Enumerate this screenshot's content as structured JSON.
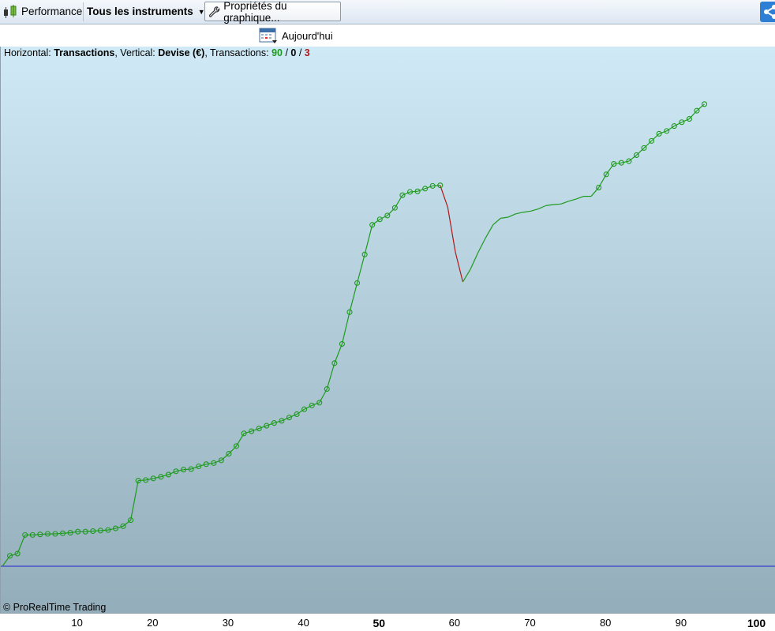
{
  "toolbar": {
    "performance_label": "Performance",
    "instruments_label": "Tous les instruments",
    "properties_label": "Propriétés du graphique..."
  },
  "subbar": {
    "today_label": "Aujourd'hui"
  },
  "info": {
    "horizontal_prefix": "Horizontal: ",
    "horizontal_value": "Transactions",
    "vertical_prefix": ", Vertical: ",
    "vertical_value": "Devise (€)",
    "transactions_prefix": ", Transactions: ",
    "winning": "90",
    "sep1": " / ",
    "neutral": "0",
    "sep2": " / ",
    "losing": "3"
  },
  "copyright": "© ProRealTime Trading",
  "colors": {
    "gain": "#1e9a1e",
    "loss": "#b01818",
    "baseline": "#2222cc"
  },
  "chart_data": {
    "type": "line",
    "x_ticks": [
      "10",
      "20",
      "30",
      "40",
      "50",
      "60",
      "70",
      "80",
      "90",
      "100"
    ],
    "major_ticks": [
      "50",
      "100"
    ],
    "xlim": [
      0,
      100
    ],
    "ylim": [
      0,
      100
    ],
    "series": [
      {
        "points": [
          [
            0,
            0
          ],
          [
            1,
            1.9
          ],
          [
            2,
            2.3
          ],
          [
            3,
            5.7
          ],
          [
            4,
            5.7
          ],
          [
            5,
            5.8
          ],
          [
            6,
            5.9
          ],
          [
            7,
            5.9
          ],
          [
            8,
            6.0
          ],
          [
            9,
            6.1
          ],
          [
            10,
            6.3
          ],
          [
            11,
            6.3
          ],
          [
            12,
            6.4
          ],
          [
            13,
            6.5
          ],
          [
            14,
            6.6
          ],
          [
            15,
            6.9
          ],
          [
            16,
            7.3
          ],
          [
            17,
            8.4
          ],
          [
            18,
            15.6
          ],
          [
            19,
            15.7
          ],
          [
            20,
            16.0
          ],
          [
            21,
            16.3
          ],
          [
            22,
            16.7
          ],
          [
            23,
            17.3
          ],
          [
            24,
            17.6
          ],
          [
            25,
            17.7
          ],
          [
            26,
            18.2
          ],
          [
            27,
            18.6
          ],
          [
            28,
            18.8
          ],
          [
            29,
            19.3
          ],
          [
            30,
            20.5
          ],
          [
            31,
            21.9
          ],
          [
            32,
            24.2
          ],
          [
            33,
            24.6
          ],
          [
            34,
            25.1
          ],
          [
            35,
            25.6
          ],
          [
            36,
            26.1
          ],
          [
            37,
            26.5
          ],
          [
            38,
            27.1
          ],
          [
            39,
            27.7
          ],
          [
            40,
            28.6
          ],
          [
            41,
            29.3
          ],
          [
            42,
            29.8
          ],
          [
            43,
            32.3
          ],
          [
            44,
            37.0
          ],
          [
            45,
            40.5
          ],
          [
            46,
            46.3
          ],
          [
            47,
            51.6
          ],
          [
            48,
            56.8
          ],
          [
            49,
            62.2
          ],
          [
            50,
            63.2
          ],
          [
            51,
            63.9
          ],
          [
            52,
            65.3
          ],
          [
            53,
            67.6
          ],
          [
            54,
            68.2
          ],
          [
            55,
            68.3
          ],
          [
            56,
            68.8
          ],
          [
            57,
            69.3
          ],
          [
            58,
            69.4
          ],
          [
            59,
            65.4
          ],
          [
            60,
            57.3
          ],
          [
            61,
            51.8
          ],
          [
            62,
            54.1
          ],
          [
            63,
            57.1
          ],
          [
            64,
            59.8
          ],
          [
            65,
            62.2
          ],
          [
            66,
            63.4
          ],
          [
            67,
            63.6
          ],
          [
            68,
            64.2
          ],
          [
            69,
            64.5
          ],
          [
            70,
            64.7
          ],
          [
            71,
            65.1
          ],
          [
            72,
            65.7
          ],
          [
            73,
            65.9
          ],
          [
            74,
            66.0
          ],
          [
            75,
            66.5
          ],
          [
            76,
            66.9
          ],
          [
            77,
            67.4
          ],
          [
            78,
            67.4
          ],
          [
            79,
            69.0
          ],
          [
            80,
            71.4
          ],
          [
            81,
            73.3
          ],
          [
            82,
            73.5
          ],
          [
            83,
            73.8
          ],
          [
            84,
            74.9
          ],
          [
            85,
            76.2
          ],
          [
            86,
            77.5
          ],
          [
            87,
            78.8
          ],
          [
            88,
            79.3
          ],
          [
            89,
            80.2
          ],
          [
            90,
            80.9
          ],
          [
            91,
            81.5
          ],
          [
            92,
            83.0
          ],
          [
            93,
            84.2
          ]
        ],
        "markers_at": [
          1,
          2,
          3,
          4,
          5,
          6,
          7,
          8,
          9,
          10,
          11,
          12,
          13,
          14,
          15,
          16,
          17,
          18,
          19,
          20,
          21,
          22,
          23,
          24,
          25,
          26,
          27,
          28,
          29,
          30,
          31,
          32,
          33,
          34,
          35,
          36,
          37,
          38,
          39,
          40,
          41,
          42,
          43,
          44,
          45,
          46,
          47,
          48,
          49,
          50,
          51,
          52,
          53,
          54,
          55,
          56,
          57,
          58,
          79,
          80,
          81,
          82,
          83,
          84,
          85,
          86,
          87,
          88,
          89,
          90,
          91,
          92,
          93
        ],
        "loss_segments": [
          [
            58,
            59
          ],
          [
            59,
            60
          ],
          [
            60,
            61
          ]
        ]
      }
    ],
    "baseline": 0
  }
}
